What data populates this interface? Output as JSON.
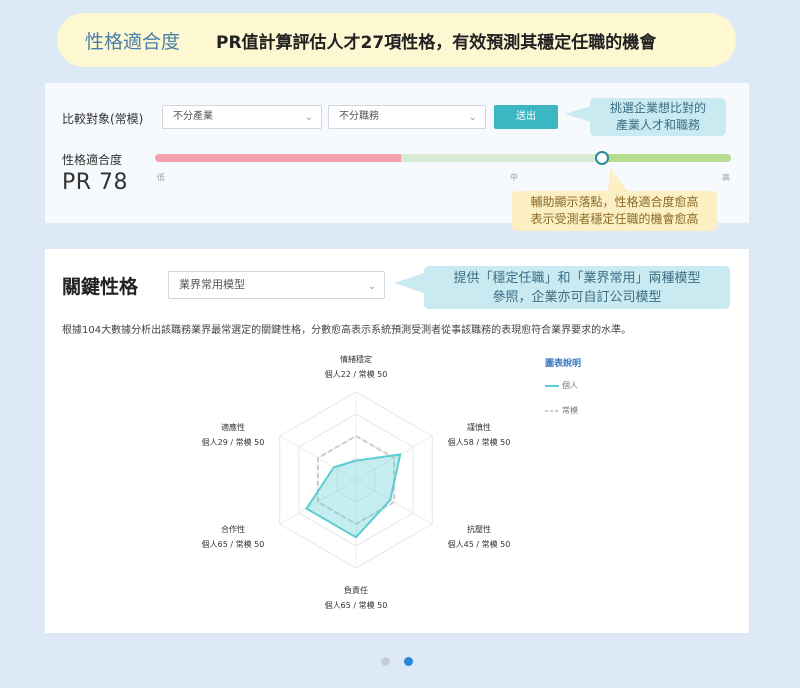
{
  "header": {
    "label": "性格適合度",
    "headline": "PR值計算評估人才27項性格，有效預測其穩定任職的機會"
  },
  "compare": {
    "label": "比較對象(常模)",
    "industry_select": "不分產業",
    "job_select": "不分職務",
    "submit_label": "送出",
    "tip": [
      "挑選企業想比對的",
      "產業人才和職務"
    ]
  },
  "fit": {
    "label": "性格適合度",
    "pr_text": "PR 78",
    "pr_value": 78,
    "scale_low": "低",
    "scale_mid": "中",
    "scale_high": "高",
    "tip": [
      "輔助顯示落點，性格適合度愈高",
      "表示受測者穩定任職的機會愈高"
    ]
  },
  "key": {
    "title": "關鍵性格",
    "model_select": "業界常用模型",
    "tip": [
      "提供「穩定任職」和「業界常用」兩種模型",
      "參照，企業亦可自訂公司模型"
    ],
    "description": "根據104大數據分析出該職務業界最常選定的關鍵性格，分數愈高表示系統預測受測者從事該職務的表現愈符合業界要求的水準。"
  },
  "legend": {
    "title": "圖表說明",
    "personal": "個人",
    "norm": "常模"
  },
  "colors": {
    "personal": "#5ccdd3",
    "norm": "#cccccc",
    "accent": "#3cb6c2"
  },
  "chart_data": {
    "type": "radar",
    "max": 100,
    "axes": [
      {
        "name": "情緒穩定",
        "label": "個人22 / 常模 50",
        "personal": 22,
        "norm": 50
      },
      {
        "name": "謹慎性",
        "label": "個人58 / 常模 50",
        "personal": 58,
        "norm": 50
      },
      {
        "name": "抗壓性",
        "label": "個人45 / 常模 50",
        "personal": 45,
        "norm": 50
      },
      {
        "name": "負責任",
        "label": "個人65 / 常模 50",
        "personal": 65,
        "norm": 50
      },
      {
        "name": "合作性",
        "label": "個人65 / 常模 50",
        "personal": 65,
        "norm": 50
      },
      {
        "name": "適應性",
        "label": "個人29 / 常模 50",
        "personal": 29,
        "norm": 50
      }
    ],
    "series": [
      {
        "name": "個人",
        "key": "personal"
      },
      {
        "name": "常模",
        "key": "norm"
      }
    ]
  },
  "pagination": {
    "total": 2,
    "active": 2
  }
}
